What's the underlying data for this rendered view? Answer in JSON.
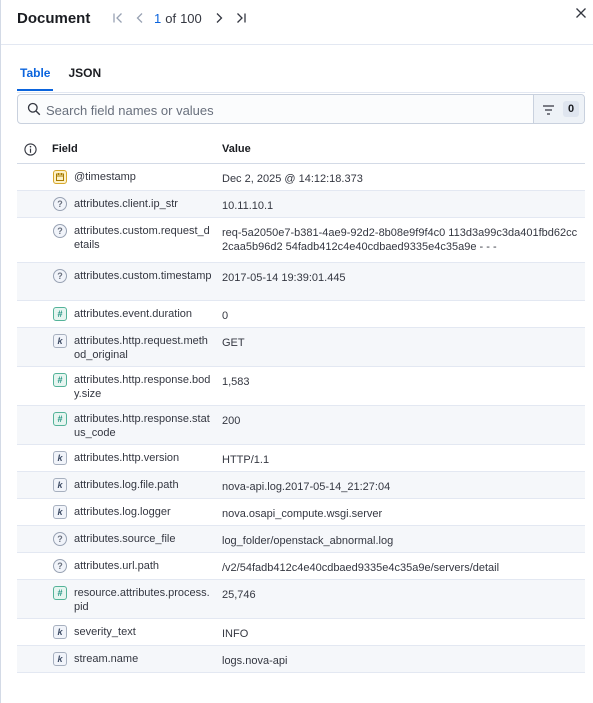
{
  "header": {
    "title": "Document",
    "pager": {
      "current": "1",
      "of": "of",
      "total": "100"
    }
  },
  "tabs": [
    {
      "label": "Table",
      "active": true
    },
    {
      "label": "JSON",
      "active": false
    }
  ],
  "search": {
    "placeholder": "Search field names or values",
    "filter_count": "0"
  },
  "table": {
    "headers": {
      "field": "Field",
      "value": "Value"
    },
    "rows": [
      {
        "type": "date",
        "field": "@timestamp",
        "value": "Dec 2, 2025 @ 14:12:18.373"
      },
      {
        "type": "unknown",
        "field": "attributes.client.ip_str",
        "value": "10.11.10.1"
      },
      {
        "type": "unknown",
        "field": "attributes.custom.request_details",
        "value": "req-5a2050e7-b381-4ae9-92d2-8b08e9f9f4c0 113d3a99c3da401fbd62cc2caa5b96d2 54fadb412c4e40cdbaed9335e4c35a9e - - -"
      },
      {
        "type": "unknown",
        "field": "attributes.custom.timestamp",
        "value": "2017-05-14 19:39:01.445"
      },
      {
        "type": "number",
        "field": "attributes.event.duration",
        "value": "0"
      },
      {
        "type": "keyword",
        "field": "attributes.http.request.method_original",
        "value": "GET"
      },
      {
        "type": "number",
        "field": "attributes.http.response.body.size",
        "value": "1,583"
      },
      {
        "type": "number",
        "field": "attributes.http.response.status_code",
        "value": "200"
      },
      {
        "type": "keyword",
        "field": "attributes.http.version",
        "value": "HTTP/1.1"
      },
      {
        "type": "keyword",
        "field": "attributes.log.file.path",
        "value": "nova-api.log.2017-05-14_21:27:04"
      },
      {
        "type": "keyword",
        "field": "attributes.log.logger",
        "value": "nova.osapi_compute.wsgi.server"
      },
      {
        "type": "unknown",
        "field": "attributes.source_file",
        "value": "log_folder/openstack_abnormal.log"
      },
      {
        "type": "unknown",
        "field": "attributes.url.path",
        "value": "/v2/54fadb412c4e40cdbaed9335e4c35a9e/servers/detail"
      },
      {
        "type": "number",
        "field": "resource.attributes.process.pid",
        "value": "25,746"
      },
      {
        "type": "keyword",
        "field": "severity_text",
        "value": "INFO"
      },
      {
        "type": "keyword",
        "field": "stream.name",
        "value": "logs.nova-api"
      }
    ]
  },
  "icons": {
    "first": "first-page-icon",
    "prev": "previous-page-icon",
    "next": "next-page-icon",
    "last": "last-page-icon",
    "close": "close-icon",
    "search": "search-icon",
    "filter": "filter-icon",
    "info": "info-icon"
  },
  "colors": {
    "accent": "#0b64dd",
    "keyword_badge": "#f1f4fa",
    "number_badge": "#e6f5f0",
    "date_badge": "#fdf1c8"
  }
}
